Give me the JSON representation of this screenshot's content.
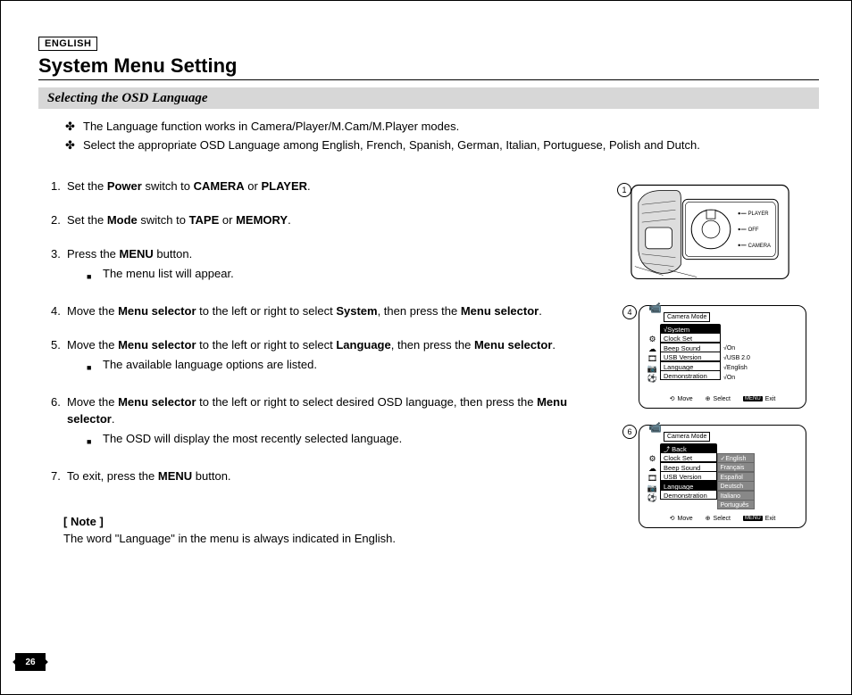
{
  "header": {
    "lang": "ENGLISH",
    "title": "System Menu Setting"
  },
  "subtitle": "Selecting the OSD Language",
  "bullets": [
    "The Language function works in Camera/Player/M.Cam/M.Player modes.",
    "Select the appropriate OSD Language among English, French, Spanish, German, Italian, Portuguese, Polish and Dutch."
  ],
  "steps": {
    "s1": {
      "num": "1.",
      "pre": "Set the ",
      "b1": "Power",
      "mid": " switch to ",
      "b2": "CAMERA",
      "or": " or ",
      "b3": "PLAYER",
      "post": "."
    },
    "s2": {
      "num": "2.",
      "pre": "Set the ",
      "b1": "Mode",
      "mid": " switch to ",
      "b2": "TAPE",
      "or": " or ",
      "b3": "MEMORY",
      "post": "."
    },
    "s3": {
      "num": "3.",
      "pre": "Press the ",
      "b1": "MENU",
      "post": " button.",
      "sub": "The menu list will appear."
    },
    "s4": {
      "num": "4.",
      "pre": "Move the ",
      "b1": "Menu selector",
      "mid": " to the left or right to select ",
      "b2": "System",
      "mid2": ", then press the ",
      "b3": "Menu selector",
      "post": "."
    },
    "s5": {
      "num": "5.",
      "pre": "Move the ",
      "b1": "Menu selector",
      "mid": " to the left or right to select ",
      "b2": "Language",
      "mid2": ", then press the ",
      "b3": "Menu selector",
      "post": ".",
      "sub": "The available language options are listed."
    },
    "s6": {
      "num": "6.",
      "pre": "Move the ",
      "b1": "Menu selector",
      "mid": " to the left or right to select desired OSD language, then press the ",
      "b2": "Menu selector",
      "post": ".",
      "sub": "The OSD will display the most recently selected language."
    },
    "s7": {
      "num": "7.",
      "pre": "To exit, press the ",
      "b1": "MENU",
      "post": " button."
    }
  },
  "note": {
    "label": "[ Note ]",
    "text": "The word \"Language\" in the menu is always indicated in English."
  },
  "diagrams": {
    "d1": {
      "num": "1",
      "switch_labels": [
        "PLAYER",
        "OFF",
        "CAMERA"
      ]
    },
    "d4": {
      "num": "4",
      "mode": "Camera Mode",
      "system_row": "√System",
      "items": [
        "Clock Set",
        "Beep Sound",
        "USB Version",
        "Language",
        "Demonstration"
      ],
      "values": [
        "",
        "√On",
        "√USB 2.0",
        "√English",
        "√On"
      ]
    },
    "d6": {
      "num": "6",
      "mode": "Camera Mode",
      "back_row": "Back",
      "items": [
        "Clock Set",
        "Beep Sound",
        "USB Version",
        "Language",
        "Demonstration"
      ],
      "langs": [
        "English",
        "Français",
        "Español",
        "Deutsch",
        "Italiano",
        "Português"
      ],
      "checkmark": "✓"
    },
    "footer": {
      "move": "Move",
      "select": "Select",
      "menu": "MENU",
      "exit": "Exit"
    }
  },
  "page_number": "26"
}
